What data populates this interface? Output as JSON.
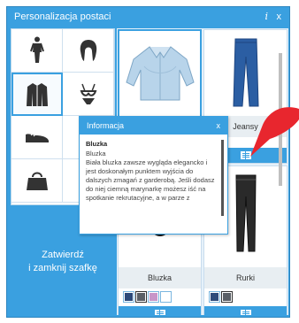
{
  "window": {
    "title": "Personalizacja postaci",
    "info_glyph": "i",
    "close_glyph": "x"
  },
  "categories": [
    {
      "icon": "body-icon"
    },
    {
      "icon": "hair-icon"
    },
    {
      "icon": "jacket-icon"
    },
    {
      "icon": "bikini-icon"
    },
    {
      "icon": "shoes-icon"
    },
    {
      "icon": "necklace-icon"
    },
    {
      "icon": "bag-icon"
    },
    {
      "icon": "tshirt-icon"
    }
  ],
  "confirm_button": {
    "line1": "Zatwierdź",
    "line2": "i zamknij szafkę"
  },
  "items": [
    {
      "name": "",
      "icon": "shirt-item-icon"
    },
    {
      "name": "Jeansy",
      "icon": "jeans-item-icon"
    },
    {
      "name": "Bluzka",
      "icon": "striped-top-item-icon",
      "swatches": [
        "#2d4a7a",
        "#5a5f66",
        "#c895c8",
        "#ffffff"
      ]
    },
    {
      "name": "Rurki",
      "icon": "skinny-pants-item-icon",
      "swatches": [
        "#2d4a7a",
        "#5a5f66"
      ]
    }
  ],
  "popup": {
    "title": "Informacja",
    "close_glyph": "x",
    "item_name": "Bluzka",
    "subtitle": "Bluzka",
    "description": "Biała bluzka zawsze wygląda elegancko i jest doskonałym punktem wyjścia do dalszych zmagań z garderobą. Jeśli dodasz do niej ciemną marynarkę możesz iść na spotkanie rekrutacyjne, a w parze z"
  },
  "colors": {
    "accent": "#3aa0e0",
    "marker": "#e8262e"
  }
}
